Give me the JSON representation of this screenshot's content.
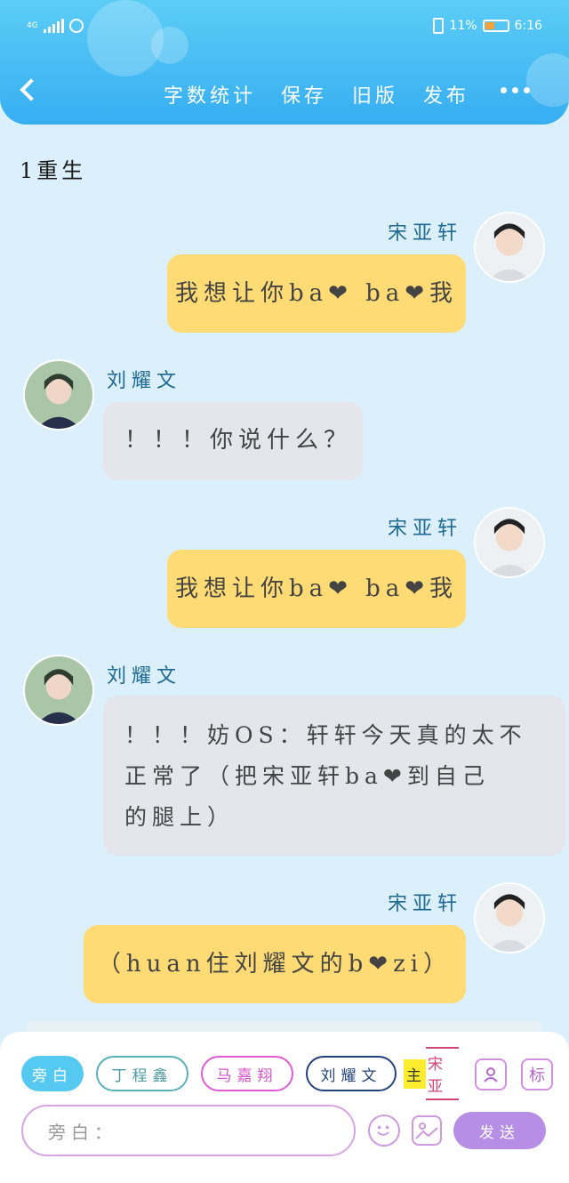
{
  "status_bar": {
    "network": "4G",
    "battery_percent": "11%",
    "time": "6:16"
  },
  "header": {
    "actions": [
      "字数统计",
      "保存",
      "旧版",
      "发布"
    ]
  },
  "chapter_title": "1重生",
  "messages": [
    {
      "speaker": "宋亚轩",
      "side": "right",
      "text": "我想让你ba❤ ba❤我"
    },
    {
      "speaker": "刘耀文",
      "side": "left",
      "text": "！！！你说什么？"
    },
    {
      "speaker": "宋亚轩",
      "side": "right",
      "text": "我想让你ba❤ ba❤我"
    },
    {
      "speaker": "刘耀文",
      "side": "left",
      "lines": [
        "！！！妨OS：轩轩今天真的太不",
        "正常了（把宋亚轩ba❤到自己",
        "的腿上）"
      ]
    },
    {
      "speaker": "宋亚轩",
      "side": "right",
      "text": "（huan住刘耀文的b❤zi）"
    }
  ],
  "composer": {
    "roles": [
      "旁白",
      "丁程鑫",
      "马嘉翔",
      "刘耀文"
    ],
    "partial_role": {
      "highlight": "主",
      "name": "宋亚"
    },
    "tag_button": "标",
    "input_placeholder": "旁白：",
    "send_label": "发送"
  },
  "colors": {
    "header": "#36aef2",
    "yellow_bubble": "#fedb74",
    "grey_bubble": "#e4e6ec",
    "send_button": "#b78ee6"
  }
}
